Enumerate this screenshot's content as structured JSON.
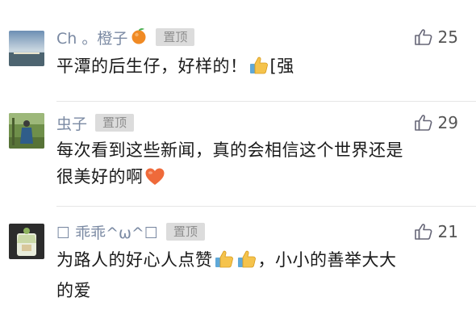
{
  "comments": [
    {
      "nickname": "Ch 。橙子",
      "name_emoji": "orange-emoji",
      "badge": "置顶",
      "likes": "25",
      "text": "平潭的后生仔，好样的！",
      "trailing_emoji": "thumbs-up-emoji",
      "trailing_text": "[强"
    },
    {
      "nickname": "虫子",
      "badge": "置顶",
      "likes": "29",
      "text_line1": "每次看到这些新闻，真的会相信这个世界还是",
      "text_line2": "很美好的啊",
      "trailing_emoji": "heart-emoji"
    },
    {
      "nickname": "☐ 乖乖^ω^☐",
      "badge": "置顶",
      "likes": "21",
      "text_part1": "为路人的好心人点赞",
      "text_part2": "，小小的善举大大",
      "text_line2": "的爱",
      "inline_emojis": [
        "thumbs-up-emoji",
        "thumbs-up-emoji"
      ]
    }
  ],
  "colors": {
    "nickname": "#7b8aa3",
    "badge_bg": "#dcdcdc",
    "badge_text": "#8e8e8e",
    "comment_text": "#1a1a1a",
    "like": "#555555"
  }
}
